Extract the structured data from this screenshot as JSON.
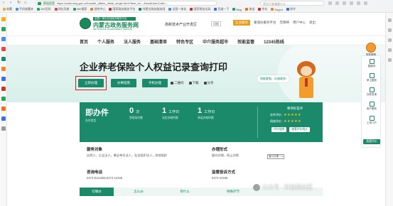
{
  "browser": {
    "site_badge": "网站信息",
    "url": "https://zwfw.nmg.gov.cn/handle_affairs_detail_single.html?item_id=...&localUserCode=...",
    "search_placeholder": "黑芯片被骗要什么",
    "bookmarks": [
      {
        "label": "收藏",
        "color": "#f2b01e"
      },
      {
        "label": "手机收藏夹",
        "color": "#4a8fe7"
      },
      {
        "label": "360百科",
        "color": "#2aa55a"
      },
      {
        "label": "网址导航",
        "color": "#e04848"
      },
      {
        "label": "360搜索",
        "color": "#2aa55a"
      },
      {
        "label": "游戏中心",
        "color": "#e8872b"
      },
      {
        "label": "国家政务服务平台",
        "color": "#c0392b"
      },
      {
        "label": "内蒙古政务服务网",
        "color": "#1a8a6a"
      },
      {
        "label": "全国一体化",
        "color": "#4a8fe7"
      },
      {
        "label": "国家税务总局",
        "color": "#c0392b"
      },
      {
        "label": "百度一下",
        "color": "#3b6ee0"
      },
      {
        "label": "Bing",
        "color": "#1f9c8a"
      },
      {
        "label": "淘宝",
        "color": "#f36c21"
      },
      {
        "label": "京东",
        "color": "#e02020"
      },
      {
        "label": "Sogou",
        "color": "#e8872b"
      },
      {
        "label": "知乎",
        "color": "#3b6ee0"
      }
    ]
  },
  "header": {
    "logo_badge": "全国一体化在线政务服务平台",
    "logo_name": "内蒙古政务服务网",
    "logo_sub": "NEI MONGOL GOVERNMENT SERVICE",
    "region": "高新技术产业开发区",
    "switch_label": "切换",
    "enterprise_label": "企业服务",
    "links": [
      "蒙速办服务平台",
      "无障碍",
      "用户中心",
      "退出"
    ]
  },
  "nav": [
    "首页",
    "个人服务",
    "法人服务",
    "基础清单",
    "特色专区",
    "中介服务超市",
    "效能监督",
    "12345热线"
  ],
  "service": {
    "title": "企业养老保险个人权益记录查询打印",
    "buttons": {
      "apply_online": "立即办理",
      "guide": "办事指南",
      "offline": "手机办理"
    },
    "tools": [
      "二维码",
      "下载",
      "分享"
    ],
    "bubble": "智能客服，玩遍政务!"
  },
  "info": {
    "type_big": "即办件",
    "type_label": "办件类型",
    "visits_value": "0",
    "visits_unit": "次",
    "visits_label": "到现场次数",
    "legal_value": "1",
    "legal_unit": "工作日",
    "legal_label": "法定办结时限",
    "promise_value": "1",
    "promise_unit": "工作日",
    "promise_label": "承诺办结时限",
    "rating_title": "事项好差评",
    "rating_rows": [
      {
        "label": "办件评价:",
        "stars": "★★★★★"
      },
      {
        "label": "网络评价:",
        "stars": "★★★★★"
      }
    ],
    "rating_buttons": [
      "评价指南",
      "查看评价统计"
    ]
  },
  "details": {
    "target_title": "服务对象",
    "target_value": "自然人，企业法人，事业单位法人，社会组织法人，其他组织",
    "form_title": "办理形式",
    "form_value": "窗口办理，网上办理",
    "tooltip": "窗口办理 + 1",
    "phone_title": "咨询电话",
    "phone_value": "0472-5112306,0472-12345",
    "supervise_title": "监督投诉方式",
    "supervise_value": "0472-12345"
  },
  "tabs": [
    "在哪办",
    "怎么办",
    "带什么",
    "特殊环节"
  ],
  "right_panel": {
    "helper": "智能客服",
    "items": [
      "智能问",
      "掌上服务",
      "办件查询",
      "用户服务",
      "工作门户"
    ],
    "feedback": "我要评价"
  },
  "watermark": "公众号 · 科技猫社区"
}
